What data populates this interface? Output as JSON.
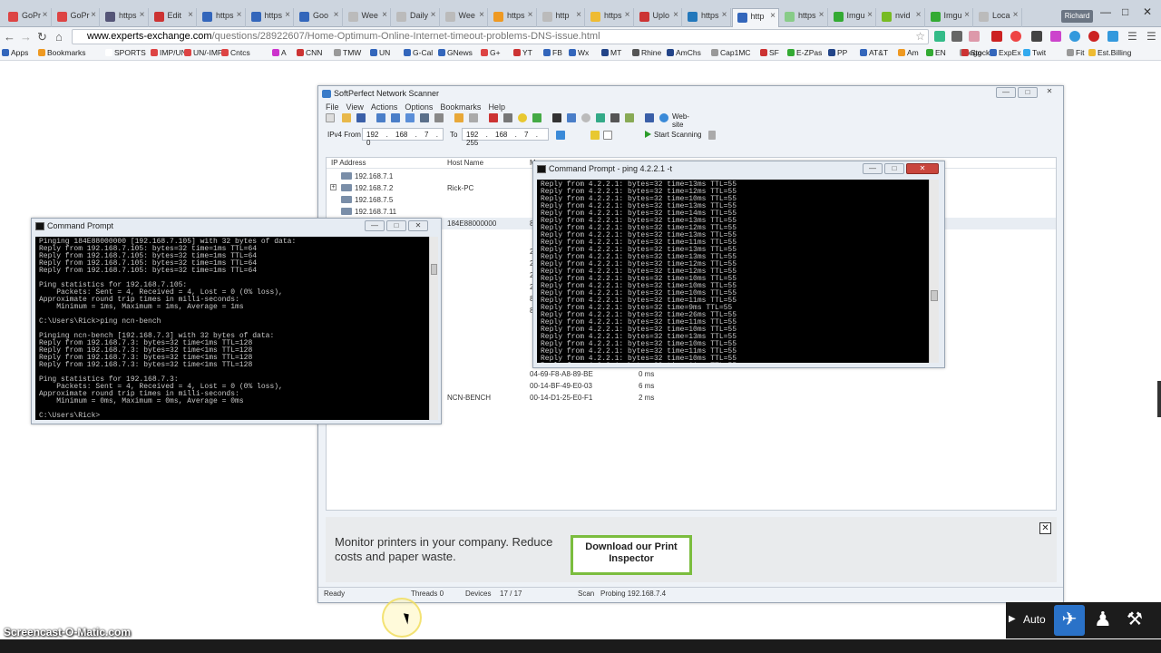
{
  "browser": {
    "tabs": [
      {
        "label": "GoPr",
        "color": "#d44"
      },
      {
        "label": "GoPr",
        "color": "#d44"
      },
      {
        "label": "https",
        "color": "#557"
      },
      {
        "label": "Edit",
        "color": "#c33"
      },
      {
        "label": "https",
        "color": "#36b"
      },
      {
        "label": "https",
        "color": "#36b"
      },
      {
        "label": "Goo",
        "color": "#36b"
      },
      {
        "label": "Wee",
        "color": "#bbb"
      },
      {
        "label": "Daily",
        "color": "#bbb"
      },
      {
        "label": "Wee",
        "color": "#bbb"
      },
      {
        "label": "https",
        "color": "#e92"
      },
      {
        "label": "http",
        "color": "#bbb"
      },
      {
        "label": "https",
        "color": "#eb3"
      },
      {
        "label": "Uplo",
        "color": "#c33"
      },
      {
        "label": "https",
        "color": "#27b"
      },
      {
        "label": "http",
        "color": "#36b"
      },
      {
        "label": "https",
        "color": "#8c8"
      },
      {
        "label": "Imgu",
        "color": "#3a3"
      },
      {
        "label": "nvid",
        "color": "#7b2"
      },
      {
        "label": "Imgu",
        "color": "#3a3"
      },
      {
        "label": "Loca",
        "color": "#bbb"
      }
    ],
    "active_tab_index": 15,
    "profile": "Richard",
    "url_host": "www.experts-exchange.com",
    "url_path": "/questions/28922607/Home-Optimum-Online-Internet-timeout-problems-DNS-issue.html",
    "bookmarks": [
      {
        "label": "Apps",
        "color": "#36b"
      },
      {
        "label": "Bookmarks",
        "color": "#e92"
      },
      {
        "label": "SPORTS",
        "color": "#fff"
      },
      {
        "label": "IMP/UN",
        "color": "#d44"
      },
      {
        "label": "UN/-IMP",
        "color": "#d44"
      },
      {
        "label": "Cntcs",
        "color": "#d44"
      },
      {
        "label": "A",
        "color": "#c3c"
      },
      {
        "label": "CNN",
        "color": "#c33"
      },
      {
        "label": "TMW",
        "color": "#999"
      },
      {
        "label": "UN",
        "color": "#36b"
      },
      {
        "label": "G-Cal",
        "color": "#36b"
      },
      {
        "label": "GNews",
        "color": "#36b"
      },
      {
        "label": "G+",
        "color": "#d44"
      },
      {
        "label": "YT",
        "color": "#c33"
      },
      {
        "label": "FB",
        "color": "#36b"
      },
      {
        "label": "Wx",
        "color": "#36b"
      },
      {
        "label": "MT",
        "color": "#248"
      },
      {
        "label": "Rhine",
        "color": "#555"
      },
      {
        "label": "AmChs",
        "color": "#248"
      },
      {
        "label": "Cap1MC",
        "color": "#999"
      },
      {
        "label": "SF",
        "color": "#c33"
      },
      {
        "label": "E-ZPas",
        "color": "#3a3"
      },
      {
        "label": "PP",
        "color": "#248"
      },
      {
        "label": "AT&T",
        "color": "#36b"
      },
      {
        "label": "Am",
        "color": "#e92"
      },
      {
        "label": "EN",
        "color": "#3a3"
      },
      {
        "label": "egg",
        "color": "#999"
      },
      {
        "label": "Stock",
        "color": "#c33"
      },
      {
        "label": "ExpEx",
        "color": "#36b"
      },
      {
        "label": "Twit",
        "color": "#3ae"
      },
      {
        "label": "Fit",
        "color": "#999"
      },
      {
        "label": "Est.Billing",
        "color": "#eb3"
      }
    ]
  },
  "scanner": {
    "title": "SoftPerfect Network Scanner",
    "menu": [
      "File",
      "View",
      "Actions",
      "Options",
      "Bookmarks",
      "Help"
    ],
    "website_label": "Web-site",
    "ipv4_from_label": "IPv4 From",
    "ip_from": "192 . 168 . 7 . 0",
    "to_label": "To",
    "ip_to": "192 . 168 . 7 . 255",
    "start_label": "Start Scanning",
    "columns": [
      "IP Address",
      "Host Name",
      "M"
    ],
    "rows": [
      {
        "ip": "192.168.7.1",
        "host": "",
        "mac": "",
        "time": ""
      },
      {
        "ip": "192.168.7.2",
        "host": "Rick-PC",
        "mac": "",
        "time": "",
        "expand": "+"
      },
      {
        "ip": "192.168.7.5",
        "host": "",
        "mac": "",
        "time": ""
      },
      {
        "ip": "192.168.7.11",
        "host": "",
        "mac": "",
        "time": ""
      },
      {
        "ip": "",
        "host": "184E88000000",
        "mac": "8",
        "time": ""
      }
    ],
    "lower_rows": [
      {
        "ip": "",
        "host": "",
        "mac": "04-69-F8-A8-89-BE",
        "time": "0 ms"
      },
      {
        "ip": "",
        "host": "",
        "mac": "00-14-BF-49-E0-03",
        "time": "6 ms"
      },
      {
        "ip": "",
        "host": "NCN-BENCH",
        "mac": "00-14-D1-25-E0-F1",
        "time": "2 ms"
      }
    ],
    "side_digits": [
      "2",
      "2",
      "2",
      "2",
      "8",
      "8"
    ],
    "ad_text": "Monitor printers in your company. Reduce costs and paper waste.",
    "ad_button": "Download our Print Inspector",
    "status_ready": "Ready",
    "status_threads": "Threads  0",
    "status_devices": "Devices",
    "status_devices_count": "17 / 17",
    "status_scan": "Scan",
    "status_probing": "Probing 192.168.7.4"
  },
  "cmd_left": {
    "title": "Command Prompt",
    "text": "Pinging 184E88000000 [192.168.7.105] with 32 bytes of data:\nReply from 192.168.7.105: bytes=32 time=1ms TTL=64\nReply from 192.168.7.105: bytes=32 time=1ms TTL=64\nReply from 192.168.7.105: bytes=32 time=1ms TTL=64\nReply from 192.168.7.105: bytes=32 time=1ms TTL=64\n\nPing statistics for 192.168.7.105:\n    Packets: Sent = 4, Received = 4, Lost = 0 (0% loss),\nApproximate round trip times in milli-seconds:\n    Minimum = 1ms, Maximum = 1ms, Average = 1ms\n\nC:\\Users\\Rick>ping ncn-bench\n\nPinging ncn-bench [192.168.7.3] with 32 bytes of data:\nReply from 192.168.7.3: bytes=32 time<1ms TTL=128\nReply from 192.168.7.3: bytes=32 time<1ms TTL=128\nReply from 192.168.7.3: bytes=32 time<1ms TTL=128\nReply from 192.168.7.3: bytes=32 time<1ms TTL=128\n\nPing statistics for 192.168.7.3:\n    Packets: Sent = 4, Received = 4, Lost = 0 (0% loss),\nApproximate round trip times in milli-seconds:\n    Minimum = 0ms, Maximum = 0ms, Average = 0ms\n\nC:\\Users\\Rick>"
  },
  "cmd_right": {
    "title": "Command Prompt - ping  4.2.2.1 -t",
    "text": "Reply from 4.2.2.1: bytes=32 time=13ms TTL=55\nReply from 4.2.2.1: bytes=32 time=12ms TTL=55\nReply from 4.2.2.1: bytes=32 time=10ms TTL=55\nReply from 4.2.2.1: bytes=32 time=13ms TTL=55\nReply from 4.2.2.1: bytes=32 time=14ms TTL=55\nReply from 4.2.2.1: bytes=32 time=13ms TTL=55\nReply from 4.2.2.1: bytes=32 time=12ms TTL=55\nReply from 4.2.2.1: bytes=32 time=13ms TTL=55\nReply from 4.2.2.1: bytes=32 time=11ms TTL=55\nReply from 4.2.2.1: bytes=32 time=13ms TTL=55\nReply from 4.2.2.1: bytes=32 time=13ms TTL=55\nReply from 4.2.2.1: bytes=32 time=12ms TTL=55\nReply from 4.2.2.1: bytes=32 time=12ms TTL=55\nReply from 4.2.2.1: bytes=32 time=10ms TTL=55\nReply from 4.2.2.1: bytes=32 time=10ms TTL=55\nReply from 4.2.2.1: bytes=32 time=10ms TTL=55\nReply from 4.2.2.1: bytes=32 time=11ms TTL=55\nReply from 4.2.2.1: bytes=32 time=9ms TTL=55\nReply from 4.2.2.1: bytes=32 time=26ms TTL=55\nReply from 4.2.2.1: bytes=32 time=11ms TTL=55\nReply from 4.2.2.1: bytes=32 time=10ms TTL=55\nReply from 4.2.2.1: bytes=32 time=13ms TTL=55\nReply from 4.2.2.1: bytes=32 time=10ms TTL=55\nReply from 4.2.2.1: bytes=32 time=11ms TTL=55\nReply from 4.2.2.1: bytes=32 time=10ms TTL=55\nReply from 4.2.2.1: bytes=32 time=11ms TTL=55"
  },
  "overlay": {
    "watermark": "Screencast-O-Matic.com",
    "tray_auto": "Auto"
  }
}
